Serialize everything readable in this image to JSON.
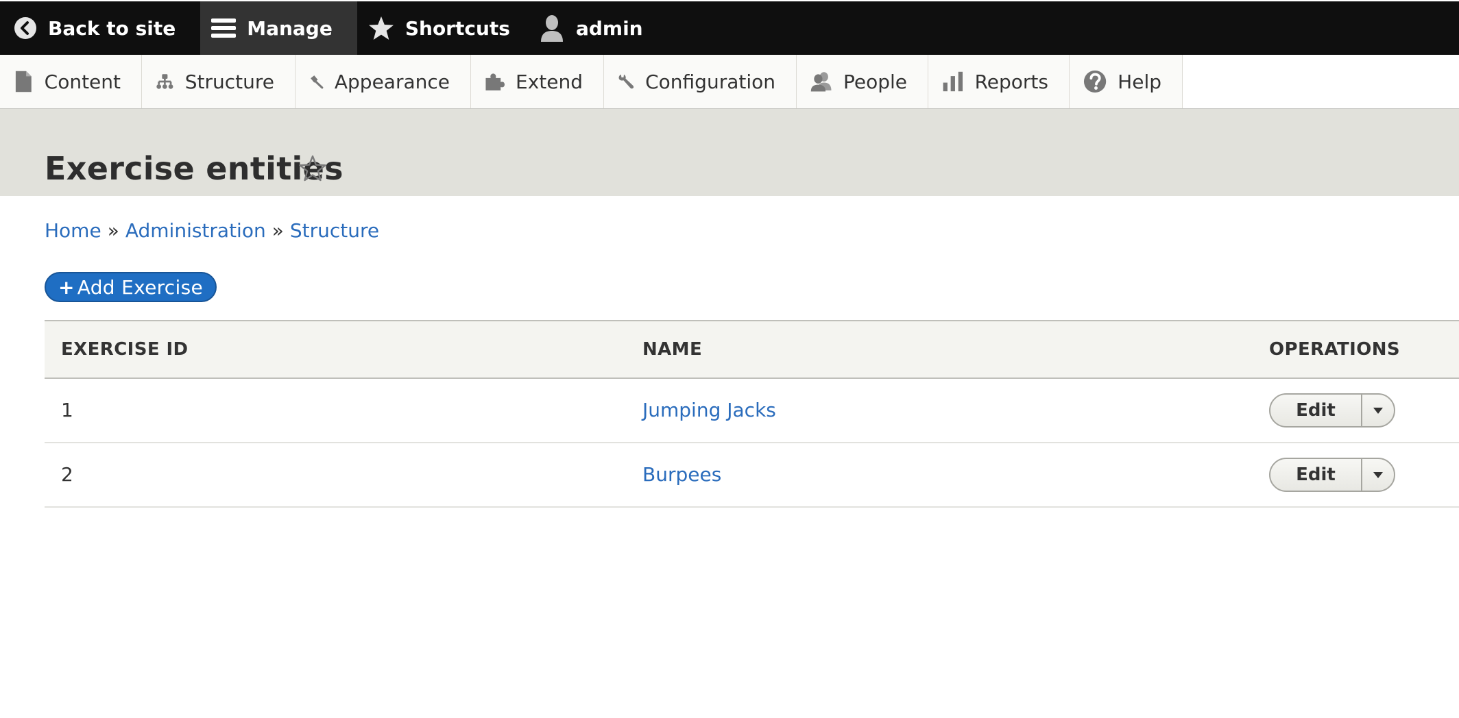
{
  "toolbar": {
    "back_label": "Back to site",
    "manage_label": "Manage",
    "shortcuts_label": "Shortcuts",
    "user_label": "admin"
  },
  "tray": {
    "items": [
      {
        "label": "Content",
        "icon": "file-icon"
      },
      {
        "label": "Structure",
        "icon": "sitemap-icon"
      },
      {
        "label": "Appearance",
        "icon": "paint-brush-icon"
      },
      {
        "label": "Extend",
        "icon": "puzzle-icon"
      },
      {
        "label": "Configuration",
        "icon": "wrench-icon"
      },
      {
        "label": "People",
        "icon": "people-icon"
      },
      {
        "label": "Reports",
        "icon": "bar-chart-icon"
      },
      {
        "label": "Help",
        "icon": "help-icon"
      }
    ]
  },
  "page": {
    "title": "Exercise entities"
  },
  "breadcrumb": {
    "items": [
      "Home",
      "Administration",
      "Structure"
    ],
    "separator": "»"
  },
  "actions": {
    "add_label": "Add Exercise",
    "add_prefix": "+"
  },
  "table": {
    "headers": [
      "Exercise ID",
      "Name",
      "Operations"
    ],
    "rows": [
      {
        "id": "1",
        "name": "Jumping Jacks",
        "op": "Edit"
      },
      {
        "id": "2",
        "name": "Burpees",
        "op": "Edit"
      }
    ]
  },
  "colors": {
    "toolbar_bg": "#0f0f0f",
    "link": "#2a6cbc",
    "primary_button": "#1f6ec3",
    "header_bg": "#e1e1db"
  }
}
